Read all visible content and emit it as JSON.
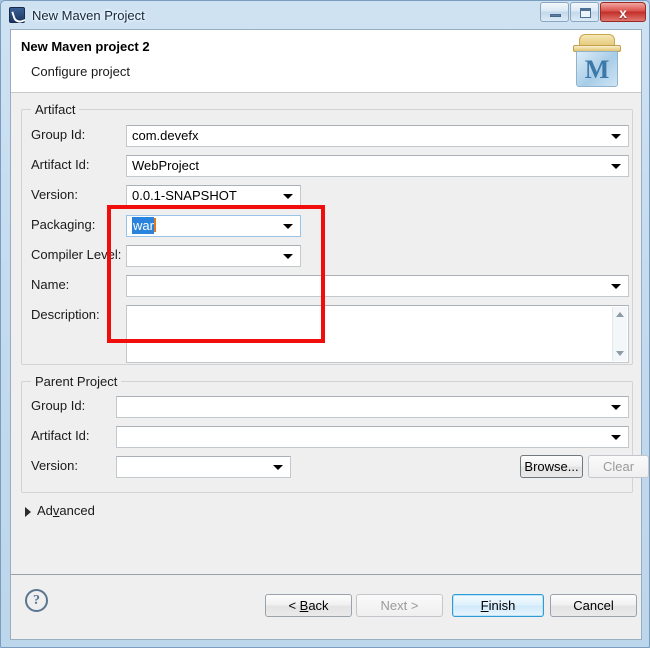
{
  "window": {
    "title": "New Maven Project",
    "icon": "maven-app-icon",
    "controls": {
      "minimize": "minimize-icon",
      "maximize": "maximize-icon",
      "close": "x"
    }
  },
  "header": {
    "title": "New Maven project 2",
    "subtitle": "Configure project",
    "icon": "maven-logo-icon",
    "icon_letter": "M"
  },
  "artifact": {
    "legend": "Artifact",
    "fields": [
      {
        "label": "Group Id:",
        "value": "com.devefx",
        "type": "combo"
      },
      {
        "label": "Artifact Id:",
        "value": "WebProject",
        "type": "combo"
      },
      {
        "label": "Version:",
        "value": "0.0.1-SNAPSHOT",
        "type": "combo"
      },
      {
        "label": "Packaging:",
        "value": "war",
        "type": "combo"
      },
      {
        "label": "Compiler Level:",
        "value": "",
        "type": "combo"
      },
      {
        "label": "Name:",
        "value": "",
        "type": "combo"
      },
      {
        "label": "Description:",
        "value": "",
        "type": "textarea"
      }
    ]
  },
  "parent": {
    "legend": "Parent Project",
    "fields": [
      {
        "label": "Group Id:",
        "value": "",
        "type": "combo"
      },
      {
        "label": "Artifact Id:",
        "value": "",
        "type": "combo"
      },
      {
        "label": "Version:",
        "value": "",
        "type": "combo"
      }
    ],
    "browse_label": "Browse...",
    "clear_label": "Clear"
  },
  "advanced": {
    "label_pre": "Ad",
    "label_mnemonic": "v",
    "label_post": "anced",
    "expander": "chevron-right-icon"
  },
  "footer": {
    "help": "?",
    "buttons": {
      "back_pre": "< ",
      "back_mnemonic": "B",
      "back_post": "ack",
      "next": "Next >",
      "finish_mnemonic": "F",
      "finish_post": "inish",
      "cancel": "Cancel"
    }
  },
  "colors": {
    "annotation": "#f20d0d",
    "selection": "#2a84de",
    "caret": "#e07b20",
    "default_button": "#2e9ad6"
  }
}
